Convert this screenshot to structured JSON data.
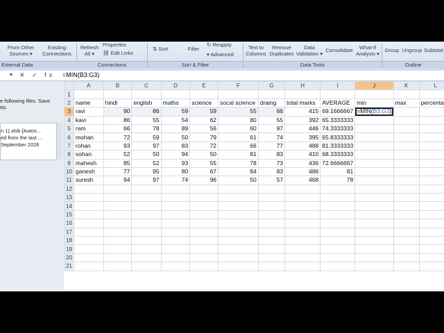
{
  "ribbon": {
    "items": [
      {
        "label": "From Other\nSources ▾"
      },
      {
        "label": "Existing\nConnections"
      },
      {
        "label": "Refresh\nAll ▾"
      },
      {
        "label": "Properties"
      },
      {
        "label": "Edit Links"
      },
      {
        "label": "Sort"
      },
      {
        "label": "Filter"
      },
      {
        "label": "Reapply"
      },
      {
        "label": "Advanced"
      },
      {
        "label": "Text to\nColumns"
      },
      {
        "label": "Remove\nDuplicates"
      },
      {
        "label": "Data\nValidation ▾"
      },
      {
        "label": "Consolidate"
      },
      {
        "label": "What-If\nAnalysis ▾"
      },
      {
        "label": "Group"
      },
      {
        "label": "Ungroup"
      },
      {
        "label": "Subtotal"
      }
    ],
    "groups": [
      "External Data",
      "Connections",
      "Sort & Filter",
      "Data Tools",
      "Outline"
    ]
  },
  "formula_bar": {
    "name_box": "▾",
    "buttons": "✕ ✓ fx",
    "formula": "=MIN(B3:G3)"
  },
  "left_pane": {
    "line1": "e following files.  Save",
    "line2": "ep.",
    "file_name": "n 1).xlsb  [Autos...",
    "file_desc": "ed from the last ...",
    "file_date": "September 2026"
  },
  "sheet": {
    "columns": [
      "A",
      "B",
      "C",
      "D",
      "E",
      "F",
      "G",
      "H",
      "I",
      "J",
      "K",
      "L"
    ],
    "header_row": [
      "name",
      "hindi",
      "english",
      "maths",
      "science",
      "socal science",
      "draing",
      "total marks",
      "AVERAGE",
      "min",
      "max",
      "percentag"
    ],
    "rows": [
      [
        "ravi",
        "90",
        "86",
        "59",
        "59",
        "55",
        "66",
        "415",
        "69.1666667"
      ],
      [
        "kavi",
        "86",
        "55",
        "54",
        "62",
        "80",
        "55",
        "392",
        "65.3333333"
      ],
      [
        "ram",
        "66",
        "78",
        "89",
        "56",
        "60",
        "97",
        "446",
        "74.3333333"
      ],
      [
        "mohan",
        "72",
        "59",
        "50",
        "79",
        "61",
        "74",
        "395",
        "65.8333333"
      ],
      [
        "rohan",
        "93",
        "97",
        "83",
        "72",
        "66",
        "77",
        "488",
        "81.3333333"
      ],
      [
        "sohan",
        "52",
        "50",
        "94",
        "50",
        "81",
        "83",
        "410",
        "68.3333333"
      ],
      [
        "mahesh",
        "85",
        "52",
        "93",
        "55",
        "78",
        "73",
        "436",
        "72.6666667"
      ],
      [
        "ganesh",
        "77",
        "95",
        "80",
        "67",
        "84",
        "83",
        "486",
        "81"
      ],
      [
        "suresh",
        "94",
        "97",
        "74",
        "96",
        "50",
        "57",
        "468",
        "78"
      ]
    ],
    "editing_cell": {
      "prefix": "=MIN(",
      "ref": "B3:G3",
      "suffix": ")"
    },
    "empty_rows": [
      "12",
      "13",
      "14",
      "15",
      "16",
      "17",
      "18",
      "19",
      "20",
      "21"
    ]
  }
}
